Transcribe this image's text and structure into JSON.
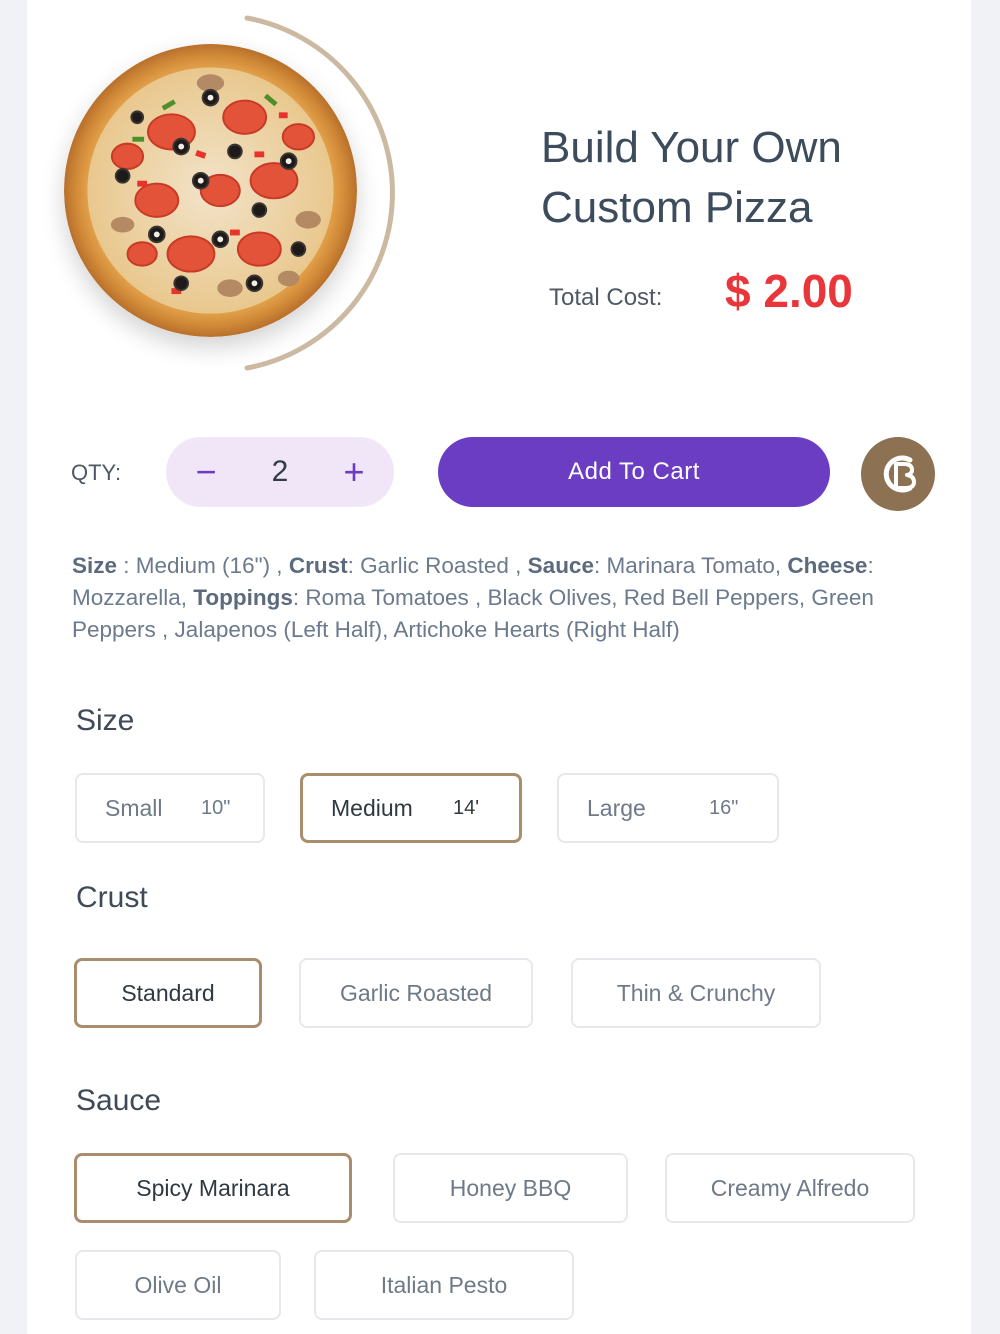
{
  "product": {
    "title_line1": "Build Your Own",
    "title_line2": "Custom Pizza",
    "total_label": "Total Cost:",
    "total_price": "$ 2.00",
    "image_icon": "pizza-image"
  },
  "cart": {
    "qty_label": "QTY:",
    "qty_value": "2",
    "minus_symbol": "−",
    "plus_symbol": "+",
    "add_to_cart_label": "Add To Cart",
    "brand_icon": "brand-logo-icon"
  },
  "summary": {
    "size_label": "Size",
    "size_value": " : Medium (16\") , ",
    "crust_label": "Crust",
    "crust_value": ": Garlic Roasted , ",
    "sauce_label": "Sauce",
    "sauce_value": ": Marinara Tomato, ",
    "cheese_label": "Cheese",
    "cheese_value": ": Mozzarella, ",
    "toppings_label": "Toppings",
    "toppings_value": ": Roma Tomatoes , Black Olives, Red Bell Peppers, Green Peppers , Jalapenos (Left Half), Artichoke Hearts (Right Half)"
  },
  "sections": {
    "size": {
      "title": "Size",
      "options": [
        {
          "name": "Small",
          "dim": "10\"",
          "selected": false
        },
        {
          "name": "Medium",
          "dim": "14'",
          "selected": true
        },
        {
          "name": "Large",
          "dim": "16\"",
          "selected": false
        }
      ]
    },
    "crust": {
      "title": "Crust",
      "options": [
        {
          "name": "Standard",
          "selected": true
        },
        {
          "name": "Garlic Roasted",
          "selected": false
        },
        {
          "name": "Thin & Crunchy",
          "selected": false
        }
      ]
    },
    "sauce": {
      "title": "Sauce",
      "options": [
        {
          "name": "Spicy Marinara",
          "selected": true
        },
        {
          "name": "Honey BBQ",
          "selected": false
        },
        {
          "name": "Creamy Alfredo",
          "selected": false
        },
        {
          "name": "Olive Oil",
          "selected": false
        },
        {
          "name": "Italian Pesto",
          "selected": false
        }
      ]
    }
  },
  "colors": {
    "accent_purple": "#6a3dc2",
    "stepper_bg": "#f1e6f7",
    "price_red": "#e8363a",
    "selected_border": "#a98e6e",
    "brand_gold": "#8c7153"
  }
}
